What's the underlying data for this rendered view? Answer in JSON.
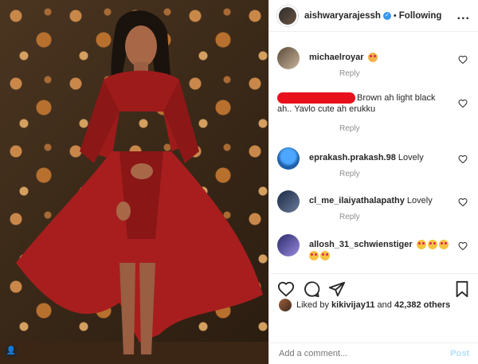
{
  "post": {
    "username": "aishwaryarajessh",
    "follow_label": "Following",
    "dot": "•",
    "more": "..."
  },
  "comments": [
    {
      "username": "michaelroyar",
      "text": "",
      "reply": "Reply"
    },
    {
      "username": "",
      "text": "Brown ah light black ah.. Yavlo cute ah erukku",
      "reply": "Reply"
    },
    {
      "username": "eprakash.prakash.98",
      "text": "Lovely",
      "reply": "Reply"
    },
    {
      "username": "cl_me_ilaiyathalapathy",
      "text": "Lovely",
      "reply": "Reply"
    },
    {
      "username": "allosh_31_schwienstiger",
      "text": ""
    }
  ],
  "likes": {
    "prefix": "Liked by ",
    "by": "kikivijay11",
    "middle": " and ",
    "count": "42,382 others"
  },
  "add_comment": {
    "placeholder": "Add a comment...",
    "post_label": "Post"
  },
  "colors": {
    "verified": "#3897f0",
    "redaction": "#e8101a",
    "dress": "#9e1b1b"
  }
}
